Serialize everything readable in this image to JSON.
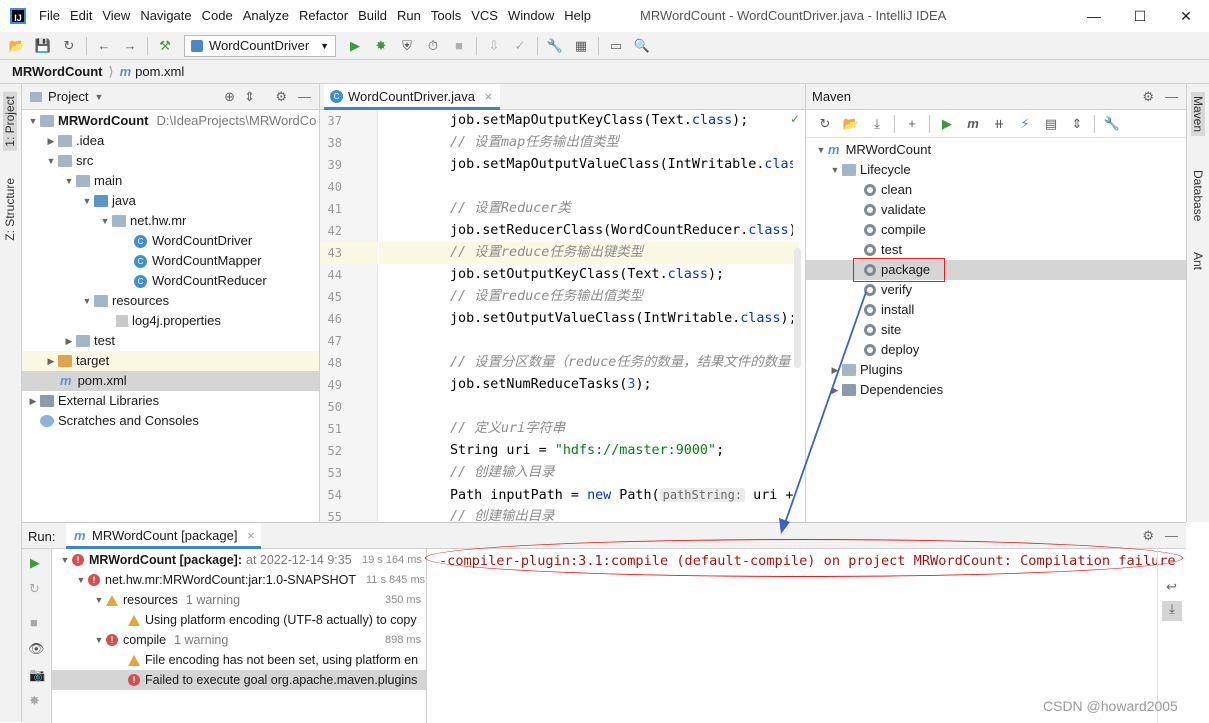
{
  "window": {
    "title": "MRWordCount - WordCountDriver.java - IntelliJ IDEA",
    "menu": [
      "File",
      "Edit",
      "View",
      "Navigate",
      "Code",
      "Analyze",
      "Refactor",
      "Build",
      "Run",
      "Tools",
      "VCS",
      "Window",
      "Help"
    ]
  },
  "toolbar": {
    "run_config": "WordCountDriver"
  },
  "navbar": {
    "project": "MRWordCount",
    "file": "pom.xml"
  },
  "left_strip": {
    "project_label": "1: Project",
    "structure_label": "Z: Structure"
  },
  "right_strip": {
    "maven_label": "Maven",
    "database_label": "Database",
    "ant_label": "Ant"
  },
  "project": {
    "header": "Project",
    "items": [
      {
        "label": "MRWordCount",
        "extra": "D:\\IdeaProjects\\MRWordCo"
      },
      {
        "label": ".idea"
      },
      {
        "label": "src"
      },
      {
        "label": "main"
      },
      {
        "label": "java"
      },
      {
        "label": "net.hw.mr"
      },
      {
        "label": "WordCountDriver"
      },
      {
        "label": "WordCountMapper"
      },
      {
        "label": "WordCountReducer"
      },
      {
        "label": "resources"
      },
      {
        "label": "log4j.properties"
      },
      {
        "label": "test"
      },
      {
        "label": "target"
      },
      {
        "label": "pom.xml"
      },
      {
        "label": "External Libraries"
      },
      {
        "label": "Scratches and Consoles"
      }
    ]
  },
  "editor": {
    "tab": "WordCountDriver.java",
    "line_numbers": [
      "37",
      "38",
      "39",
      "40",
      "41",
      "42",
      "43",
      "44",
      "45",
      "46",
      "47",
      "48",
      "49",
      "50",
      "51",
      "52",
      "53",
      "54",
      "55"
    ],
    "lines": {
      "l37": "job.setMapOutputKeyClass(Text.",
      "l37k": "class",
      "l37e": ");",
      "l38": "// 设置map任务输出值类型",
      "l39": "job.setMapOutputValueClass(IntWritable.",
      "l39k": "class",
      "l41": "// 设置Reducer类",
      "l42": "job.setReducerClass(WordCountReducer.",
      "l42k": "class",
      "l42e": ");",
      "l43": "// 设置reduce任务输出键类型",
      "l44": "job.setOutputKeyClass(Text.",
      "l44k": "class",
      "l44e": ");",
      "l45": "// 设置reduce任务输出值类型",
      "l46": "job.setOutputValueClass(IntWritable.",
      "l46k": "class",
      "l46e": ");",
      "l48": "// 设置分区数量（reduce任务的数量，结果文件的数量",
      "l49a": "job.setNumReduceTasks(",
      "l49n": "3",
      "l49e": ");",
      "l51": "// 定义uri字符串",
      "l52a": "String uri = ",
      "l52s": "\"hdfs://master:9000\"",
      "l52e": ";",
      "l53": "// 创建输入目录",
      "l54a": "Path inputPath = ",
      "l54k": "new",
      "l54b": " Path(",
      "l54h": "pathString:",
      "l54c": " uri + \"",
      "l55": "// 创建输出目录"
    }
  },
  "maven": {
    "header": "Maven",
    "root": "MRWordCount",
    "lifecycle": "Lifecycle",
    "goals": [
      "clean",
      "validate",
      "compile",
      "test",
      "package",
      "verify",
      "install",
      "site",
      "deploy"
    ],
    "plugins": "Plugins",
    "dependencies": "Dependencies"
  },
  "run": {
    "label": "Run:",
    "tab": "MRWordCount [package]",
    "tree": [
      {
        "text": "MRWordCount [package]:",
        "extra": "at 2022-12-14 9:35",
        "time": "19 s 164 ms",
        "status": "error"
      },
      {
        "text": "net.hw.mr:MRWordCount:jar:1.0-SNAPSHOT",
        "time": "11 s 845 ms",
        "status": "error"
      },
      {
        "text": "resources",
        "extra": "1 warning",
        "time": "350 ms",
        "status": "warning"
      },
      {
        "text": "Using platform encoding (UTF-8 actually) to copy",
        "status": "warning"
      },
      {
        "text": "compile",
        "extra": "1 warning",
        "time": "898 ms",
        "status": "error"
      },
      {
        "text": "File encoding has not been set, using platform en",
        "status": "warning"
      },
      {
        "text": "Failed to execute goal org.apache.maven.plugins",
        "status": "error"
      }
    ],
    "console": "-compiler-plugin:3.1:compile (default-compile) on project MRWordCount: Compilation failure"
  },
  "watermark": "CSDN @howard2005",
  "colors": {
    "annotation": "#e02020",
    "arrow": "#3a63c8",
    "selection": "#d5d5d5",
    "accent": "#4083c9"
  }
}
